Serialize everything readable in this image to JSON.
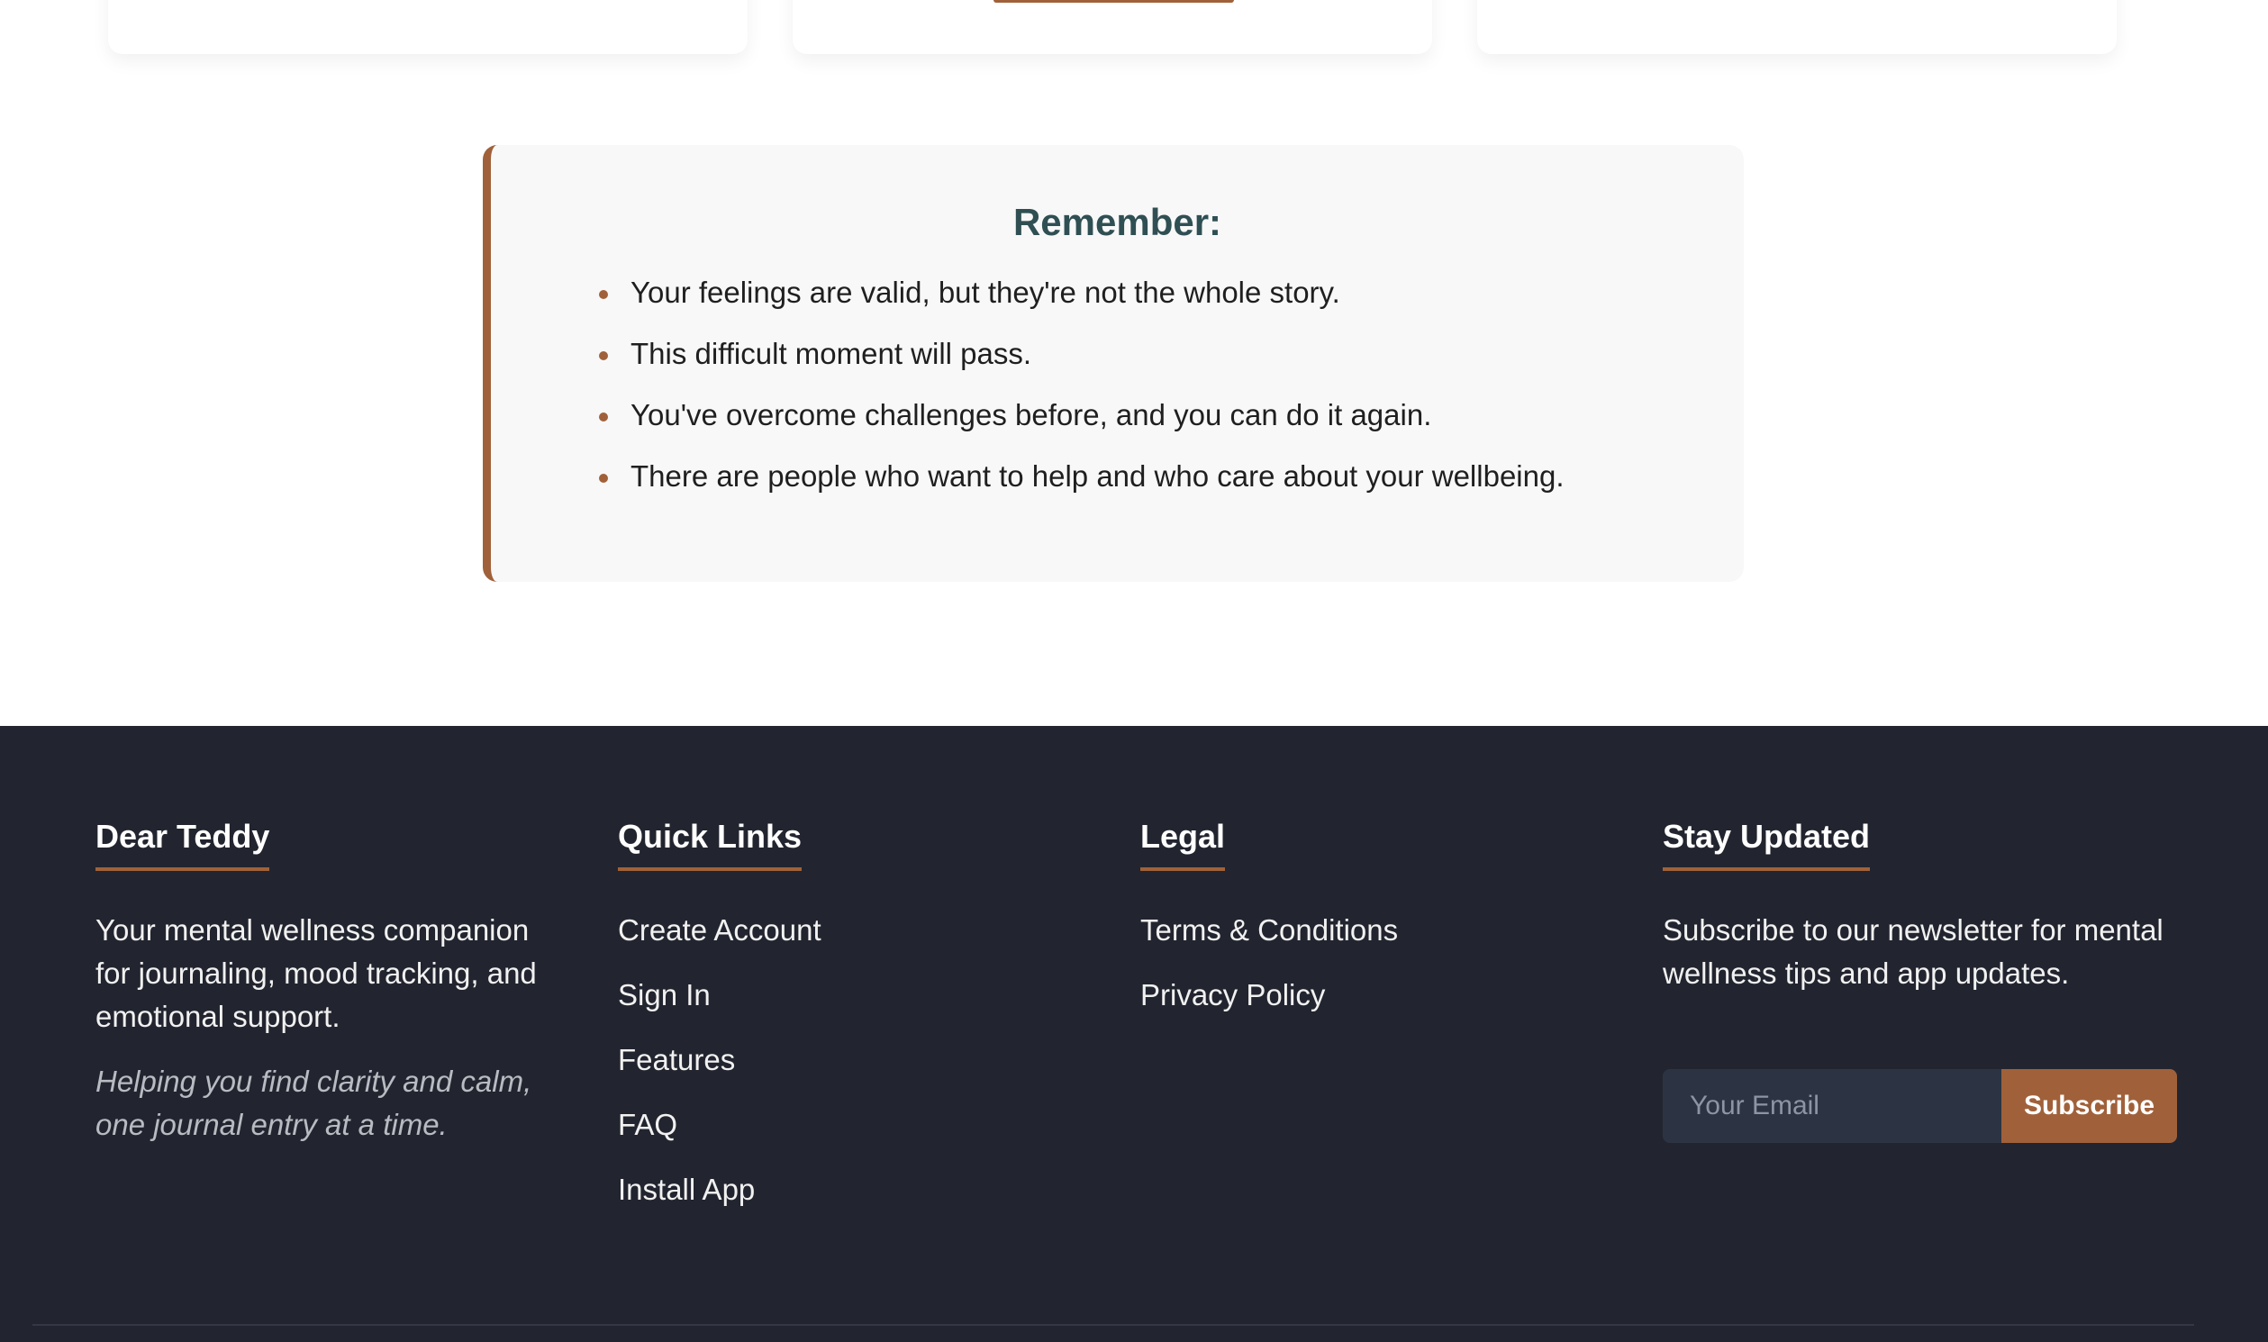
{
  "remember": {
    "title": "Remember:",
    "items": [
      "Your feelings are valid, but they're not the whole story.",
      "This difficult moment will pass.",
      "You've overcome challenges before, and you can do it again.",
      "There are people who want to help and who care about your wellbeing."
    ]
  },
  "footer": {
    "brand": {
      "heading": "Dear Teddy",
      "description": "Your mental wellness companion for journaling, mood tracking, and emotional support.",
      "tagline": "Helping you find clarity and calm, one journal entry at a time."
    },
    "quick_links": {
      "heading": "Quick Links",
      "items": [
        "Create Account",
        "Sign In",
        "Features",
        "FAQ",
        "Install App"
      ]
    },
    "legal": {
      "heading": "Legal",
      "items": [
        "Terms & Conditions",
        "Privacy Policy"
      ]
    },
    "newsletter": {
      "heading": "Stay Updated",
      "description": "Subscribe to our newsletter for mental wellness tips and app updates.",
      "email_placeholder": "Your Email",
      "button_label": "Subscribe"
    }
  },
  "colors": {
    "accent": "#a0613a",
    "footer_bg": "#22252f",
    "remember_title": "#2f4f53"
  }
}
